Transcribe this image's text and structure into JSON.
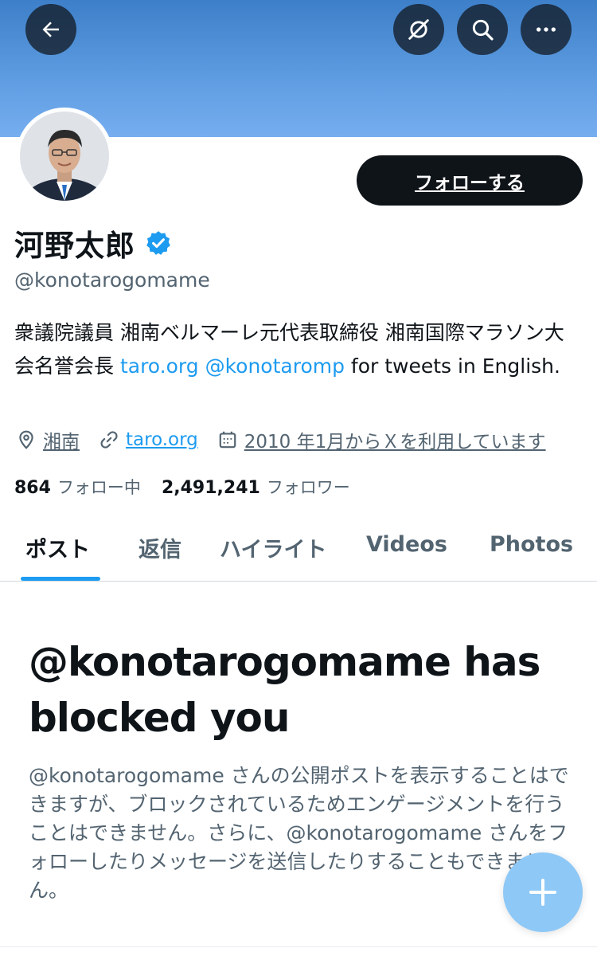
{
  "header": {
    "back_icon": "arrow-left-icon",
    "translate_icon": "translate-icon",
    "search_icon": "search-icon",
    "more_icon": "more-dots-icon",
    "banner_color": "#5d9be0"
  },
  "profile": {
    "display_name": "河野太郎",
    "verified_icon": "verified-badge-icon",
    "verified_color": "#1d9bf0",
    "handle": "@konotarogomame",
    "follow_label": "フォローする",
    "bio": {
      "text": "衆議院議員 湘南ベルマーレ元代表取締役 湘南国際マラソン大会名誉会長 ",
      "link1": "taro.org",
      "link2": "@konotaromp",
      "text_end": " for tweets in English."
    },
    "meta": {
      "location": "湘南",
      "website": "taro.org",
      "joined": "2010 年1月からＸを利用しています"
    },
    "stats": {
      "following_count": "864",
      "following_label": "フォロー中",
      "followers_count": "2,491,241",
      "followers_label": "フォロワー"
    }
  },
  "tabs": [
    {
      "label": "ポスト",
      "active": true
    },
    {
      "label": "返信",
      "active": false
    },
    {
      "label": "ハイライト",
      "active": false
    },
    {
      "label": "Videos",
      "active": false
    },
    {
      "label": "Photos",
      "active": false
    }
  ],
  "blocked": {
    "title": "@konotarogomame has blocked you",
    "description": "@konotarogomame さんの公開ポストを表示することはできますが、ブロックされているためエンゲージメントを行うことはできません。さらに、@konotarogomame さんをフォローしたりメッセージを送信したりすることもできません。"
  },
  "fab": {
    "icon": "plus-icon",
    "color": "#8ec8f6"
  }
}
